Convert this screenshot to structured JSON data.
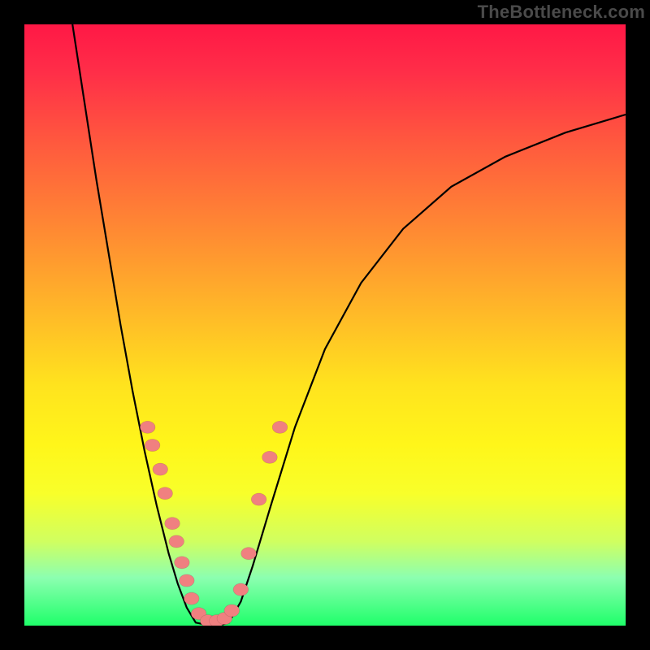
{
  "watermark": "TheBottleneck.com",
  "chart_data": {
    "type": "line",
    "title": "",
    "xlabel": "",
    "ylabel": "",
    "xlim": [
      0,
      100
    ],
    "ylim": [
      0,
      100
    ],
    "grid": false,
    "legend": false,
    "series": [
      {
        "name": "left-branch",
        "x": [
          8,
          10,
          12,
          14,
          16,
          18,
          20,
          22,
          24,
          25.5,
          27,
          28.5
        ],
        "y": [
          100,
          87,
          74,
          62,
          50,
          39,
          29,
          20,
          12,
          7,
          3,
          0.5
        ]
      },
      {
        "name": "floor",
        "x": [
          28.5,
          30,
          31.5,
          33,
          34
        ],
        "y": [
          0.5,
          0.2,
          0.2,
          0.2,
          0.5
        ]
      },
      {
        "name": "right-branch",
        "x": [
          34,
          36,
          38,
          41,
          45,
          50,
          56,
          63,
          71,
          80,
          90,
          100
        ],
        "y": [
          0.5,
          4,
          10,
          20,
          33,
          46,
          57,
          66,
          73,
          78,
          82,
          85
        ]
      }
    ],
    "markers": [
      {
        "x": 20.5,
        "y": 33
      },
      {
        "x": 21.3,
        "y": 30
      },
      {
        "x": 22.6,
        "y": 26
      },
      {
        "x": 23.4,
        "y": 22
      },
      {
        "x": 24.6,
        "y": 17
      },
      {
        "x": 25.3,
        "y": 14
      },
      {
        "x": 26.2,
        "y": 10.5
      },
      {
        "x": 27.0,
        "y": 7.5
      },
      {
        "x": 27.8,
        "y": 4.5
      },
      {
        "x": 29.0,
        "y": 2.0
      },
      {
        "x": 30.5,
        "y": 0.8
      },
      {
        "x": 32.0,
        "y": 0.8
      },
      {
        "x": 33.3,
        "y": 1.2
      },
      {
        "x": 34.5,
        "y": 2.5
      },
      {
        "x": 36.0,
        "y": 6.0
      },
      {
        "x": 37.3,
        "y": 12.0
      },
      {
        "x": 39.0,
        "y": 21.0
      },
      {
        "x": 40.8,
        "y": 28.0
      },
      {
        "x": 42.5,
        "y": 33.0
      }
    ],
    "marker_radius_frac": 0.012
  }
}
